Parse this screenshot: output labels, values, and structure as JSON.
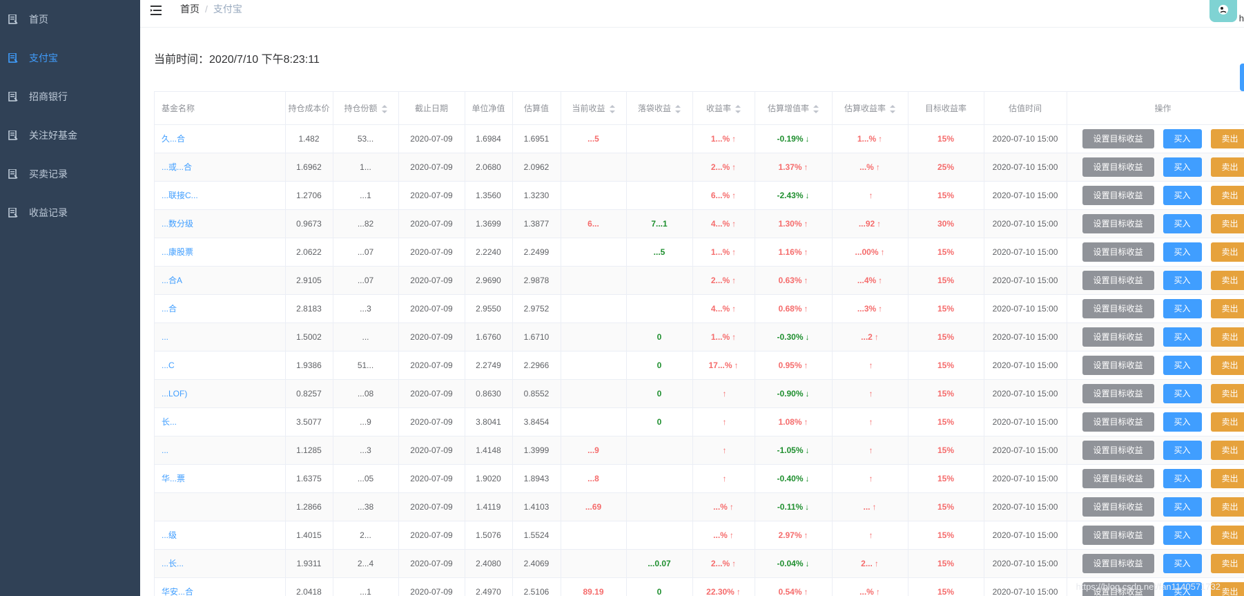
{
  "sidebar": {
    "items": [
      {
        "label": "首页",
        "active": false
      },
      {
        "label": "支付宝",
        "active": true
      },
      {
        "label": "招商银行",
        "active": false
      },
      {
        "label": "关注好基金",
        "active": false
      },
      {
        "label": "买卖记录",
        "active": false
      },
      {
        "label": "收益记录",
        "active": false
      }
    ]
  },
  "header": {
    "breadcrumb": {
      "home": "首页",
      "separator": "/",
      "current": "支付宝"
    },
    "avatar_letter": "h"
  },
  "time": {
    "label": "当前时间：",
    "value": "2020/7/10 下午8:23:11"
  },
  "table": {
    "headers": [
      "基金名称",
      "持仓成本价",
      "持仓份额",
      "截止日期",
      "单位净值",
      "估算值",
      "当前收益",
      "落袋收益",
      "收益率",
      "估算增值率",
      "估算收益率",
      "目标收益率",
      "估值时间",
      "操作"
    ],
    "actions": {
      "set_target": "设置目标收益",
      "buy": "买入",
      "sell": "卖出"
    },
    "rows": [
      {
        "name": "久...合",
        "cost": "1.482",
        "shares": "53...",
        "date": "2020-07-09",
        "nav": "1.6984",
        "est": "1.6951",
        "profit": "...5",
        "realized": "",
        "rate": "1...%",
        "est_rate": "-0.19%",
        "est_dir": "down",
        "est_profit": "1...%",
        "target": "15%",
        "time": "2020-07-10 15:00"
      },
      {
        "name": "...或...合",
        "cost": "1.6962",
        "shares": "1...",
        "date": "2020-07-09",
        "nav": "2.0680",
        "est": "2.0962",
        "profit": "",
        "realized": "",
        "rate": "2...%",
        "est_rate": "1.37%",
        "est_dir": "up",
        "est_profit": "...%",
        "target": "25%",
        "time": "2020-07-10 15:00"
      },
      {
        "name": "...联接C...",
        "cost": "1.2706",
        "shares": "...1",
        "date": "2020-07-09",
        "nav": "1.3560",
        "est": "1.3230",
        "profit": "",
        "realized": "",
        "rate": "6...%",
        "est_rate": "-2.43%",
        "est_dir": "down",
        "est_profit": "",
        "target": "15%",
        "time": "2020-07-10 15:00"
      },
      {
        "name": "...数分级",
        "cost": "0.9673",
        "shares": "...82",
        "date": "2020-07-09",
        "nav": "1.3699",
        "est": "1.3877",
        "profit": "6...",
        "realized": "7...1",
        "rate": "4...%",
        "est_rate": "1.30%",
        "est_dir": "up",
        "est_profit": "...92",
        "target": "30%",
        "time": "2020-07-10 15:00"
      },
      {
        "name": "...康股票",
        "cost": "2.0622",
        "shares": "...07",
        "date": "2020-07-09",
        "nav": "2.2240",
        "est": "2.2499",
        "profit": "",
        "realized": "...5",
        "rate": "1...%",
        "est_rate": "1.16%",
        "est_dir": "up",
        "est_profit": "...00%",
        "target": "15%",
        "time": "2020-07-10 15:00"
      },
      {
        "name": "...合A",
        "cost": "2.9105",
        "shares": "...07",
        "date": "2020-07-09",
        "nav": "2.9690",
        "est": "2.9878",
        "profit": "",
        "realized": "",
        "rate": "2...%",
        "est_rate": "0.63%",
        "est_dir": "up",
        "est_profit": "...4%",
        "target": "15%",
        "time": "2020-07-10 15:00"
      },
      {
        "name": "...合",
        "cost": "2.8183",
        "shares": "...3",
        "date": "2020-07-09",
        "nav": "2.9550",
        "est": "2.9752",
        "profit": "",
        "realized": "",
        "rate": "4...%",
        "est_rate": "0.68%",
        "est_dir": "up",
        "est_profit": "...3%",
        "target": "15%",
        "time": "2020-07-10 15:00"
      },
      {
        "name": "...",
        "cost": "1.5002",
        "shares": "...",
        "date": "2020-07-09",
        "nav": "1.6760",
        "est": "1.6710",
        "profit": "",
        "realized": "0",
        "rate": "1...%",
        "est_rate": "-0.30%",
        "est_dir": "down",
        "est_profit": "...2",
        "target": "15%",
        "time": "2020-07-10 15:00"
      },
      {
        "name": "...C",
        "cost": "1.9386",
        "shares": "51...",
        "date": "2020-07-09",
        "nav": "2.2749",
        "est": "2.2966",
        "profit": "",
        "realized": "0",
        "rate": "17...%",
        "est_rate": "0.95%",
        "est_dir": "up",
        "est_profit": "",
        "target": "15%",
        "time": "2020-07-10 15:00"
      },
      {
        "name": "...LOF)",
        "cost": "0.8257",
        "shares": "...08",
        "date": "2020-07-09",
        "nav": "0.8630",
        "est": "0.8552",
        "profit": "",
        "realized": "0",
        "rate": "",
        "est_rate": "-0.90%",
        "est_dir": "down",
        "est_profit": "",
        "target": "15%",
        "time": "2020-07-10 15:00"
      },
      {
        "name": "长...",
        "cost": "3.5077",
        "shares": "...9",
        "date": "2020-07-09",
        "nav": "3.8041",
        "est": "3.8454",
        "profit": "",
        "realized": "0",
        "rate": "",
        "est_rate": "1.08%",
        "est_dir": "up",
        "est_profit": "",
        "target": "15%",
        "time": "2020-07-10 15:00"
      },
      {
        "name": "...",
        "cost": "1.1285",
        "shares": "...3",
        "date": "2020-07-09",
        "nav": "1.4148",
        "est": "1.3999",
        "profit": "...9",
        "realized": "",
        "rate": "",
        "est_rate": "-1.05%",
        "est_dir": "down",
        "est_profit": "",
        "target": "15%",
        "time": "2020-07-10 15:00"
      },
      {
        "name": "华...票",
        "cost": "1.6375",
        "shares": "...05",
        "date": "2020-07-09",
        "nav": "1.9020",
        "est": "1.8943",
        "profit": "...8",
        "realized": "",
        "rate": "",
        "est_rate": "-0.40%",
        "est_dir": "down",
        "est_profit": "",
        "target": "15%",
        "time": "2020-07-10 15:00"
      },
      {
        "name": "",
        "cost": "1.2866",
        "shares": "...38",
        "date": "2020-07-09",
        "nav": "1.4119",
        "est": "1.4103",
        "profit": "...69",
        "realized": "",
        "rate": "...%",
        "est_rate": "-0.11%",
        "est_dir": "down",
        "est_profit": "...",
        "target": "15%",
        "time": "2020-07-10 15:00"
      },
      {
        "name": "...级",
        "cost": "1.4015",
        "shares": "2...",
        "date": "2020-07-09",
        "nav": "1.5076",
        "est": "1.5524",
        "profit": "",
        "realized": "",
        "rate": "...%",
        "est_rate": "2.97%",
        "est_dir": "up",
        "est_profit": "",
        "target": "15%",
        "time": "2020-07-10 15:00"
      },
      {
        "name": "...长...",
        "cost": "1.9311",
        "shares": "2...4",
        "date": "2020-07-09",
        "nav": "2.4080",
        "est": "2.4069",
        "profit": "",
        "realized": "...0.07",
        "rate": "2...%",
        "est_rate": "-0.04%",
        "est_dir": "down",
        "est_profit": "2...",
        "target": "15%",
        "time": "2020-07-10 15:00"
      },
      {
        "name": "华安...合",
        "cost": "2.0418",
        "shares": "...1",
        "date": "2020-07-09",
        "nav": "2.4970",
        "est": "2.5106",
        "profit": "89.19",
        "realized": "0",
        "rate": "22.30%",
        "est_rate": "0.54%",
        "est_dir": "up",
        "est_profit": "...%",
        "target": "15%",
        "time": "2020-07-10 15:00"
      }
    ]
  },
  "watermark": "https://blog.csdn.net/fan1140571732"
}
